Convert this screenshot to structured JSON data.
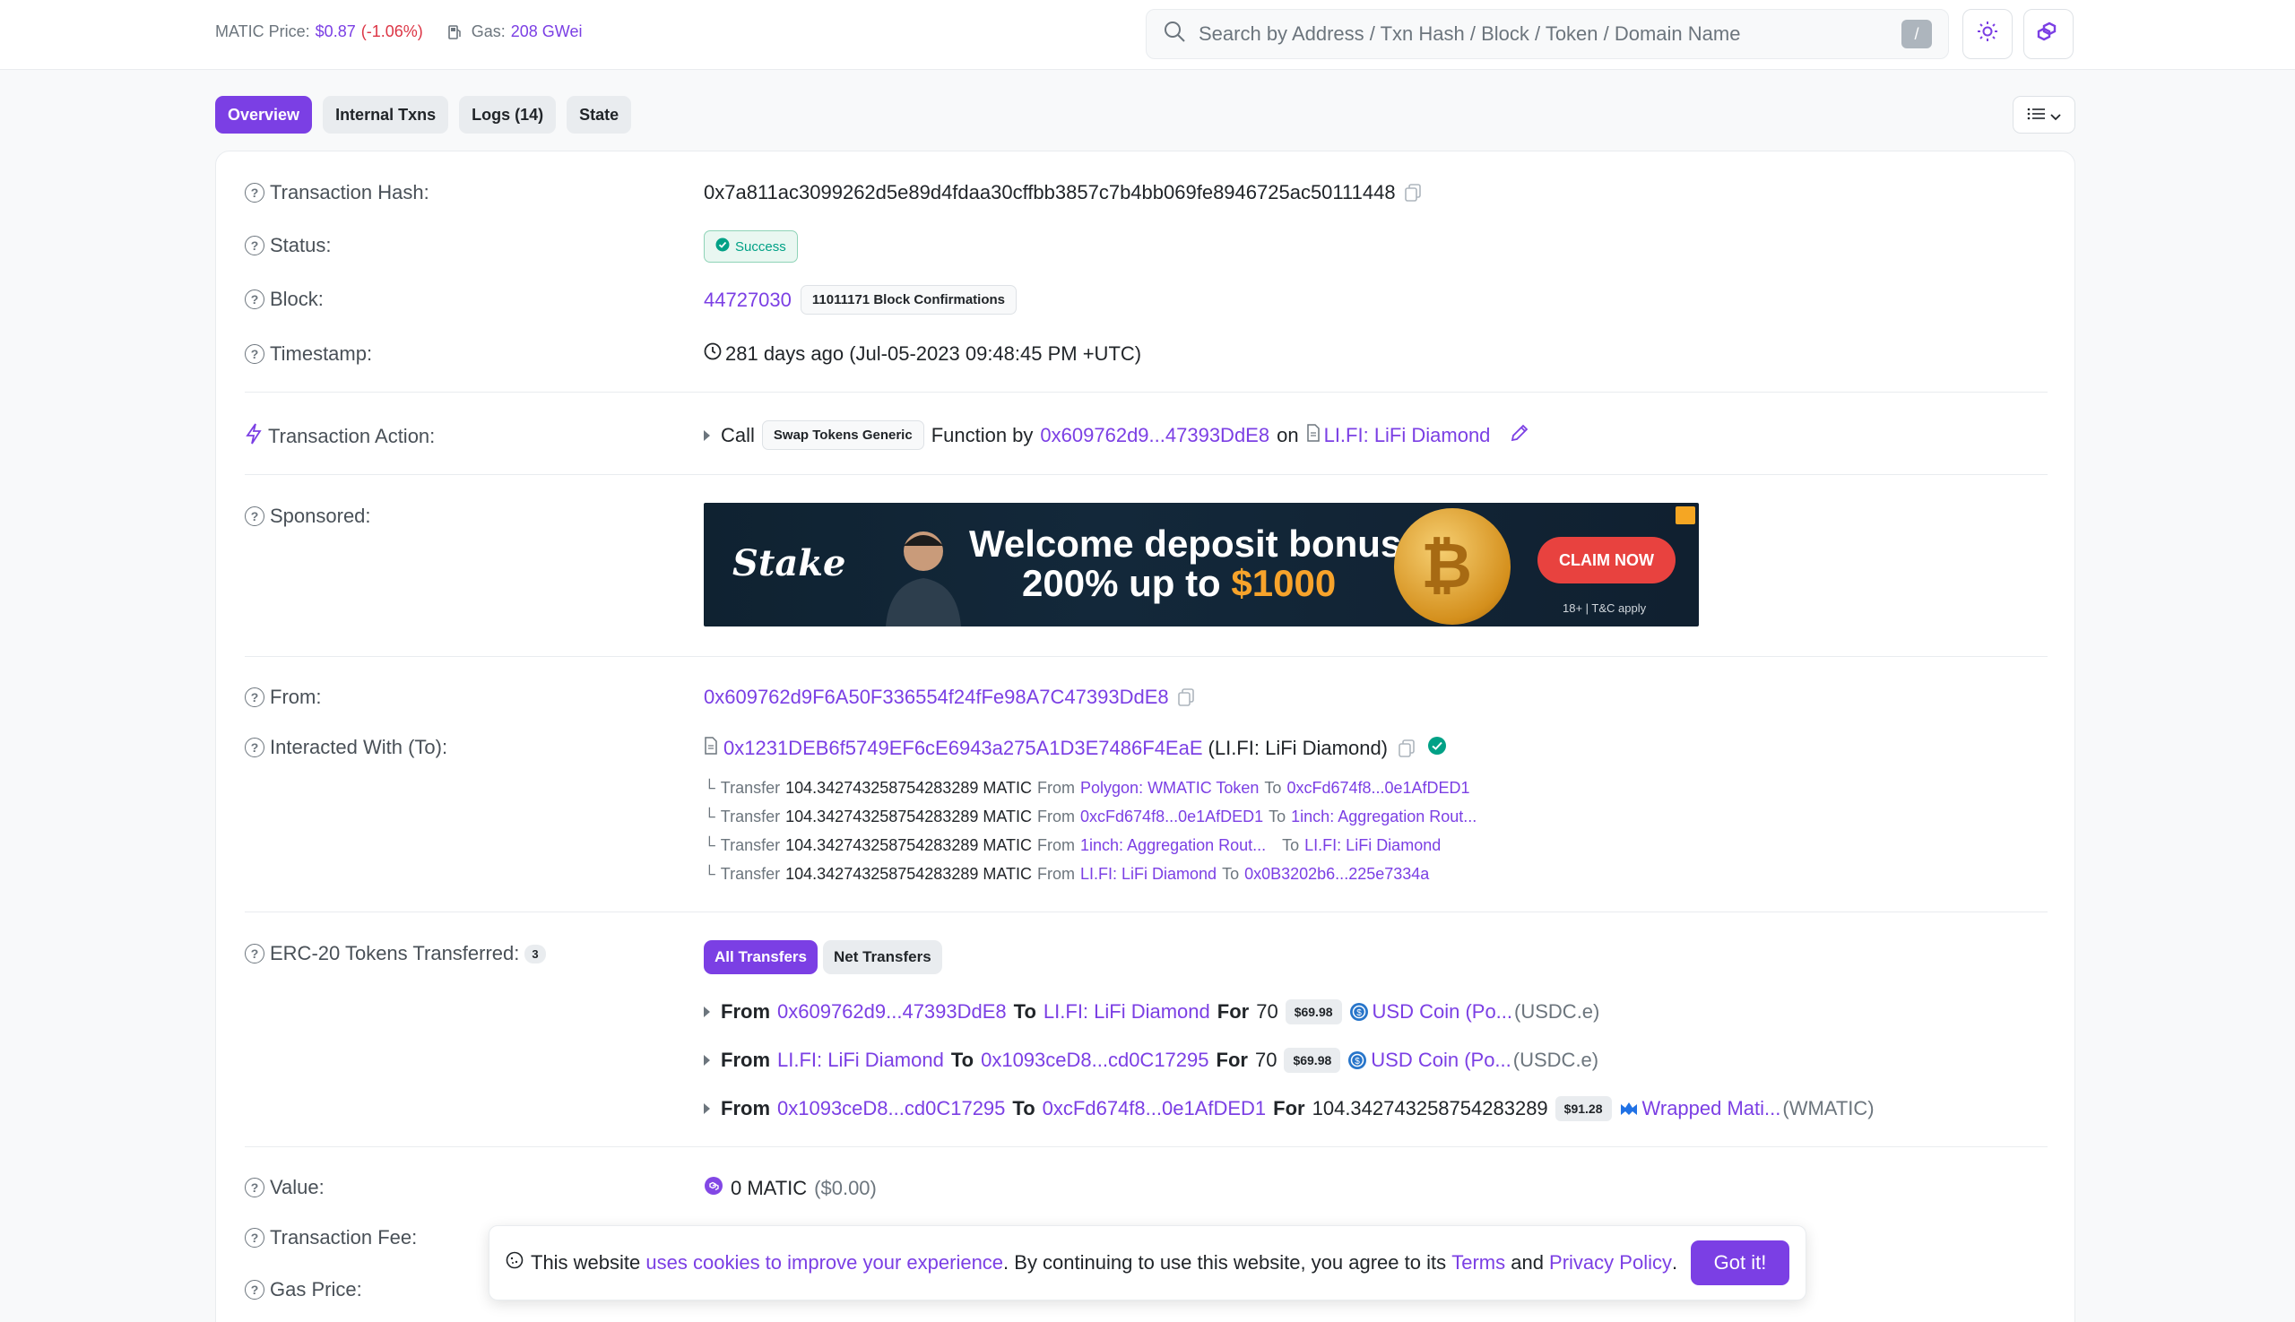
{
  "header": {
    "matic_price_label": "MATIC Price:",
    "matic_price_value": "$0.87",
    "matic_price_change": "(-1.06%)",
    "gas_label": "Gas:",
    "gas_value": "208 GWei",
    "search_placeholder": "Search by Address / Txn Hash / Block / Token / Domain Name",
    "search_shortcut": "/"
  },
  "tabs": [
    {
      "label": "Overview",
      "active": true
    },
    {
      "label": "Internal Txns",
      "active": false
    },
    {
      "label": "Logs (14)",
      "active": false
    },
    {
      "label": "State",
      "active": false
    }
  ],
  "overview": {
    "txn_hash_label": "Transaction Hash:",
    "txn_hash": "0x7a811ac3099262d5e89d4fdaa30cffbb3857c7b4bb069fe8946725ac50111448",
    "status_label": "Status:",
    "status": "Success",
    "block_label": "Block:",
    "block": "44727030",
    "block_confirmations": "11011171 Block Confirmations",
    "timestamp_label": "Timestamp:",
    "timestamp": "281 days ago (Jul-05-2023 09:48:45 PM +UTC)",
    "action_label": "Transaction Action:",
    "action_call": "Call",
    "action_method": "Swap Tokens Generic",
    "action_function_by": "Function by",
    "action_from": "0x609762d9...47393DdE8",
    "action_on": "on",
    "action_contract": "LI.FI: LiFi Diamond",
    "sponsored_label": "Sponsored:",
    "ad": {
      "brand": "Stake",
      "headline1": "Welcome deposit bonus",
      "headline2_prefix": "200% up to ",
      "headline2_amount": "$1000",
      "cta": "CLAIM NOW",
      "terms": "18+ | T&C apply"
    },
    "from_label": "From:",
    "from": "0x609762d9F6A50F336554f24fFe98A7C47393DdE8",
    "to_label": "Interacted With (To):",
    "to_address": "0x1231DEB6f5749EF6cE6943a275A1D3E7486F4EaE",
    "to_name": "(LI.FI: LiFi Diamond)",
    "internal_transfers": [
      {
        "word": "Transfer",
        "amount": "104.342743258754283289 MATIC",
        "from_word": "From",
        "from": "Polygon: WMATIC Token",
        "to_word": "To",
        "to": "0xcFd674f8...0e1AfDED1"
      },
      {
        "word": "Transfer",
        "amount": "104.342743258754283289 MATIC",
        "from_word": "From",
        "from": "0xcFd674f8...0e1AfDED1",
        "to_word": "To",
        "to": "1inch: Aggregation Rout..."
      },
      {
        "word": "Transfer",
        "amount": "104.342743258754283289 MATIC",
        "from_word": "From",
        "from": "1inch: Aggregation Rout...",
        "to_word": "To",
        "to": "LI.FI: LiFi Diamond"
      },
      {
        "word": "Transfer",
        "amount": "104.342743258754283289 MATIC",
        "from_word": "From",
        "from": "LI.FI: LiFi Diamond",
        "to_word": "To",
        "to": "0x0B3202b6...225e7334a"
      }
    ],
    "erc20_label": "ERC-20 Tokens Transferred:",
    "erc20_count": "3",
    "erc20_tabs": [
      "All Transfers",
      "Net Transfers"
    ],
    "erc20_transfers": [
      {
        "from_word": "From",
        "from": "0x609762d9...47393DdE8",
        "to_word": "To",
        "to": "LI.FI: LiFi Diamond",
        "for_word": "For",
        "amount": "70",
        "price": "$69.98",
        "token": "USD Coin (Po...",
        "symbol": "(USDC.e)"
      },
      {
        "from_word": "From",
        "from": "LI.FI: LiFi Diamond",
        "to_word": "To",
        "to": "0x1093ceD8...cd0C17295",
        "for_word": "For",
        "amount": "70",
        "price": "$69.98",
        "token": "USD Coin (Po...",
        "symbol": "(USDC.e)"
      },
      {
        "from_word": "From",
        "from": "0x1093ceD8...cd0C17295",
        "to_word": "To",
        "to": "0xcFd674f8...0e1AfDED1",
        "for_word": "For",
        "amount": "104.342743258754283289",
        "price": "$91.28",
        "token": "Wrapped Mati...",
        "symbol": "(WMATIC)"
      }
    ],
    "value_label": "Value:",
    "value": "0 MATIC",
    "value_usd": "($0.00)",
    "fee_label": "Transaction Fee:",
    "gas_price_label": "Gas Price:"
  },
  "cookie": {
    "prefix": "This website ",
    "link1": "uses cookies to improve your experience",
    "middle": ". By continuing to use this website, you agree to its ",
    "link2": "Terms",
    "and": " and ",
    "link3": "Privacy Policy",
    "suffix": ".",
    "button": "Got it!"
  },
  "colors": {
    "accent": "#7b3fe4",
    "success": "#00a186",
    "negative": "#dc3545"
  }
}
